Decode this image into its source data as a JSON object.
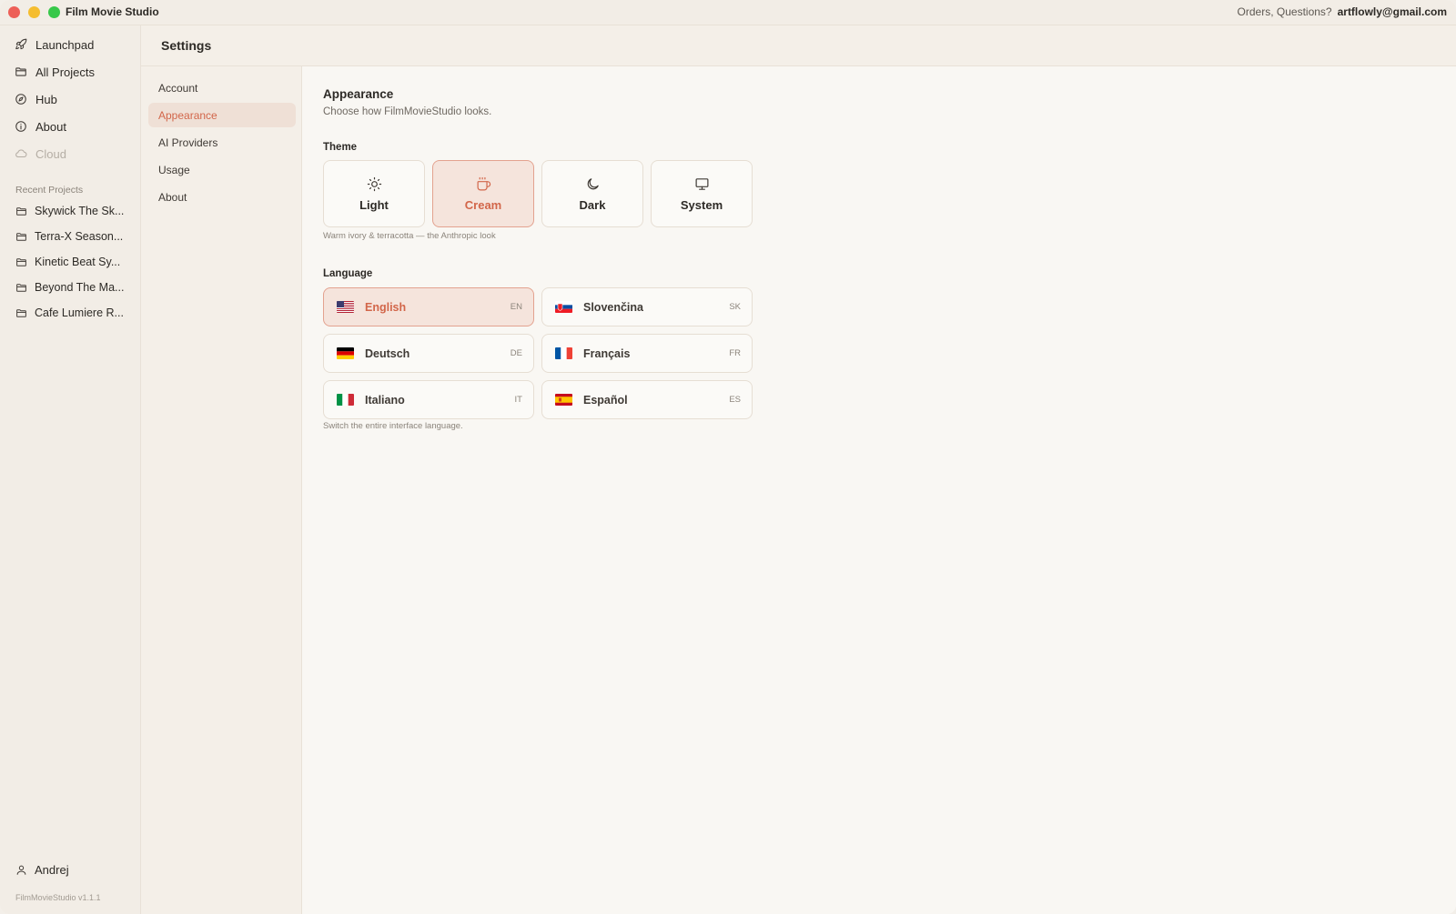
{
  "window": {
    "app_title": "Film Movie Studio",
    "orders_label": "Orders, Questions?",
    "email": "artflowly@gmail.com"
  },
  "sidebar": {
    "items": [
      {
        "label": "Launchpad",
        "icon": "rocket-icon"
      },
      {
        "label": "All Projects",
        "icon": "folder-icon"
      },
      {
        "label": "Hub",
        "icon": "compass-icon"
      },
      {
        "label": "About",
        "icon": "info-icon"
      },
      {
        "label": "Cloud",
        "icon": "cloud-icon",
        "disabled": true
      }
    ],
    "recent_label": "Recent Projects",
    "recent": [
      "Skywick The Sk...",
      "Terra-X Season...",
      "Kinetic Beat Sy...",
      "Beyond The Ma...",
      "Cafe Lumiere R..."
    ],
    "user": "Andrej",
    "version": "FilmMovieStudio v1.1.1"
  },
  "settings": {
    "title": "Settings",
    "nav": [
      "Account",
      "Appearance",
      "AI Providers",
      "Usage",
      "About"
    ],
    "active_nav": "Appearance"
  },
  "appearance": {
    "title": "Appearance",
    "subtitle": "Choose how FilmMovieStudio looks.",
    "theme_label": "Theme",
    "themes": [
      {
        "label": "Light",
        "icon": "sun-icon"
      },
      {
        "label": "Cream",
        "icon": "coffee-cup-icon"
      },
      {
        "label": "Dark",
        "icon": "moon-icon"
      },
      {
        "label": "System",
        "icon": "monitor-icon"
      }
    ],
    "selected_theme": "Cream",
    "theme_hint": "Warm ivory & terracotta — the Anthropic look",
    "language_label": "Language",
    "languages": [
      {
        "name": "English",
        "code": "EN",
        "flag": "us-flag"
      },
      {
        "name": "Slovenčina",
        "code": "SK",
        "flag": "sk-flag"
      },
      {
        "name": "Deutsch",
        "code": "DE",
        "flag": "de-flag"
      },
      {
        "name": "Français",
        "code": "FR",
        "flag": "fr-flag"
      },
      {
        "name": "Italiano",
        "code": "IT",
        "flag": "it-flag"
      },
      {
        "name": "Español",
        "code": "ES",
        "flag": "es-flag"
      }
    ],
    "selected_language": "English",
    "language_hint": "Switch the entire interface language."
  },
  "colors": {
    "accent": "#d2664a",
    "accent_bg": "#f5e4dc",
    "background": "#f9f7f3",
    "sidebar": "#f2ede6"
  }
}
